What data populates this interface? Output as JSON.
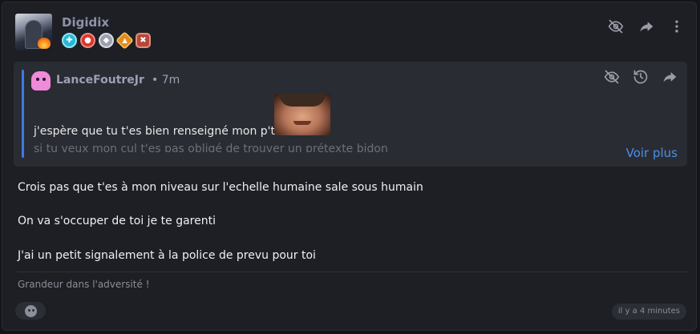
{
  "post": {
    "author": {
      "name": "Digidix",
      "badges": [
        "badge-cyan",
        "badge-red",
        "badge-silver",
        "badge-orange",
        "badge-rust"
      ]
    },
    "actions": [
      "hide-icon",
      "share-icon",
      "more-vertical-icon"
    ],
    "quote": {
      "author": "LanceFoutreJr",
      "time": "• 7m",
      "line1": "j'espère que tu t'es bien renseigné mon p'tit",
      "line2": "si tu veux mon cul t'es pas obligé de trouver un prétexte bidon",
      "see_more": "Voir plus",
      "actions": [
        "hide-icon",
        "history-icon",
        "share-icon"
      ]
    },
    "paragraphs": [
      "Crois pas que t'es à mon niveau sur l'echelle humaine sale sous humain",
      "On va s'occuper de toi je te garenti",
      "J'ai un petit signalement à la police de prevu pour toi"
    ],
    "signature": "Grandeur dans l'adversité !",
    "timestamp": "il y a 4 minutes"
  },
  "colors": {
    "accent": "#3d7be0",
    "link": "#4a90e8",
    "card": "#1e1f24",
    "quote_bg": "#2a2c33"
  }
}
